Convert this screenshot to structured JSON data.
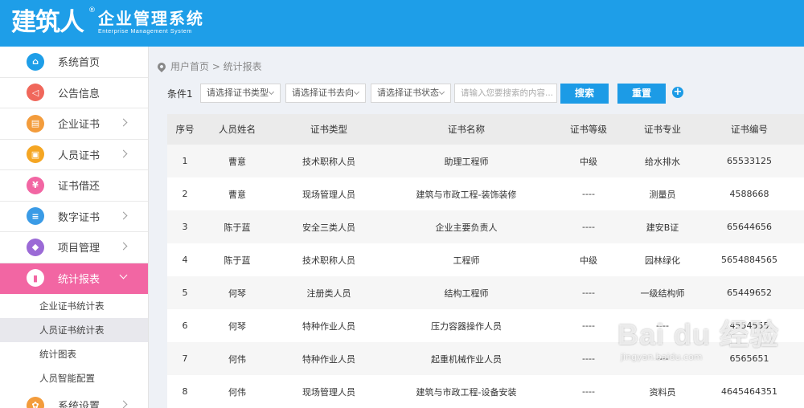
{
  "header": {
    "logo_mark": "建筑人",
    "logo_reg": "®",
    "title": "企业管理系统",
    "subtitle": "Enterprise Management System"
  },
  "sidebar": {
    "items": [
      {
        "label": "系统首页",
        "icon": "home-icon",
        "color": "#1e9ee8",
        "glyph": "⌂",
        "arrow": false
      },
      {
        "label": "公告信息",
        "icon": "megaphone-icon",
        "color": "#f0675b",
        "glyph": "◁",
        "arrow": false
      },
      {
        "label": "企业证书",
        "icon": "certificate-icon",
        "color": "#f39c3c",
        "glyph": "▤",
        "arrow": true
      },
      {
        "label": "人员证书",
        "icon": "id-card-icon",
        "color": "#f5a623",
        "glyph": "▣",
        "arrow": true
      },
      {
        "label": "证书借还",
        "icon": "yen-icon",
        "color": "#f266a3",
        "glyph": "¥",
        "arrow": false
      },
      {
        "label": "数字证书",
        "icon": "document-icon",
        "color": "#3a9be6",
        "glyph": "≡",
        "arrow": true
      },
      {
        "label": "项目管理",
        "icon": "layers-icon",
        "color": "#9b6ad6",
        "glyph": "◆",
        "arrow": true
      },
      {
        "label": "统计报表",
        "icon": "bar-chart-icon",
        "color": "#ffffff",
        "glyph": "▮",
        "arrow": true,
        "active": true
      }
    ],
    "sub_items": [
      {
        "label": "企业证书统计表"
      },
      {
        "label": "人员证书统计表",
        "selected": true
      },
      {
        "label": "统计图表"
      },
      {
        "label": "人员智能配置"
      }
    ],
    "bottom_item": {
      "label": "系统设置",
      "icon": "gear-icon",
      "color": "#f39c3c",
      "glyph": "✿"
    }
  },
  "breadcrumb": {
    "text": "用户首页 > 统计报表"
  },
  "filters": {
    "label": "条件1",
    "cert_type": "请选择证书类型",
    "cert_direction": "请选择证书去向",
    "cert_status": "请选择证书状态",
    "search_placeholder": "请输入您要搜索的内容...",
    "search_button": "搜索",
    "reset_button": "重置",
    "add_symbol": "+"
  },
  "table": {
    "columns": [
      "序号",
      "人员姓名",
      "证书类型",
      "证书名称",
      "证书等级",
      "证书专业",
      "证书编号"
    ],
    "rows": [
      [
        "1",
        "曹意",
        "技术职称人员",
        "助理工程师",
        "中级",
        "给水排水",
        "65533125"
      ],
      [
        "2",
        "曹意",
        "现场管理人员",
        "建筑与市政工程-装饰装修",
        "----",
        "测量员",
        "4588668"
      ],
      [
        "3",
        "陈于蓝",
        "安全三类人员",
        "企业主要负责人",
        "----",
        "建安B证",
        "65644656"
      ],
      [
        "4",
        "陈于蓝",
        "技术职称人员",
        "工程师",
        "中级",
        "园林绿化",
        "5654884565"
      ],
      [
        "5",
        "何琴",
        "注册类人员",
        "结构工程师",
        "----",
        "一级结构师",
        "65449652"
      ],
      [
        "6",
        "何琴",
        "特种作业人员",
        "压力容器操作人员",
        "----",
        "----",
        "4554555"
      ],
      [
        "7",
        "何伟",
        "特种作业人员",
        "起重机械作业人员",
        "----",
        "----",
        "6565651"
      ],
      [
        "8",
        "何伟",
        "现场管理人员",
        "建筑与市政工程-设备安装",
        "----",
        "资料员",
        "4645464351"
      ]
    ]
  },
  "watermark": {
    "main": "Bai du 经验",
    "sub": "jingyan.baidu.com"
  }
}
